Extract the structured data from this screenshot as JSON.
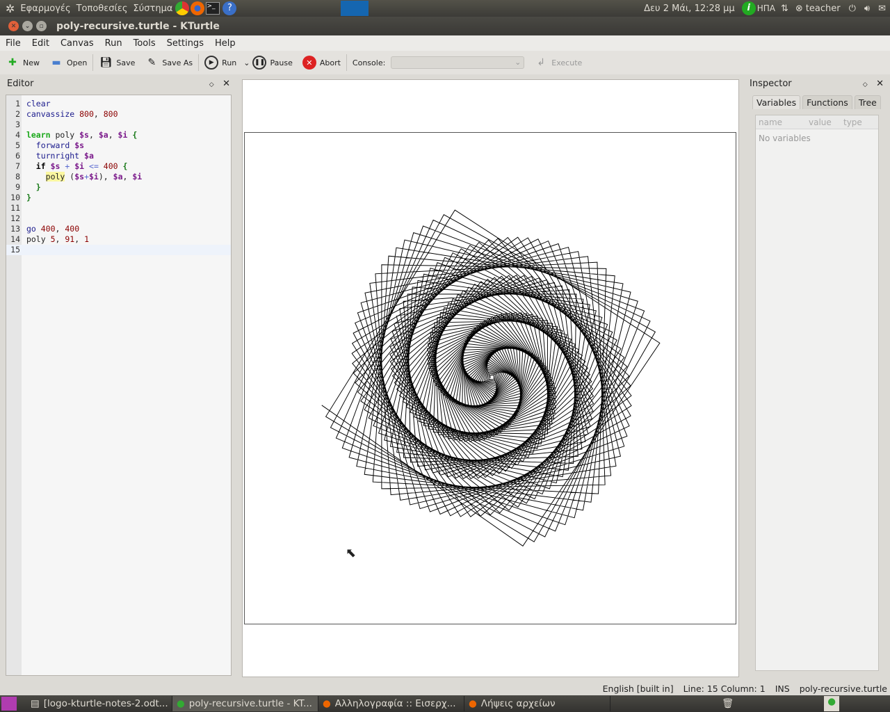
{
  "top_panel": {
    "menus": [
      "Εφαρμογές",
      "Τοποθεσίες",
      "Σύστημα"
    ],
    "clock": "Δευ  2 Μάι, 12:28 μμ",
    "keyboard": "ΗΠΑ",
    "user": "teacher"
  },
  "window": {
    "title": "poly-recursive.turtle - KTurtle"
  },
  "menubar": [
    "File",
    "Edit",
    "Canvas",
    "Run",
    "Tools",
    "Settings",
    "Help"
  ],
  "toolbar": {
    "new": "New",
    "open": "Open",
    "save": "Save",
    "save_as": "Save As",
    "run": "Run",
    "pause": "Pause",
    "abort": "Abort",
    "console_label": "Console:",
    "console_value": "",
    "execute": "Execute"
  },
  "editor": {
    "title": "Editor",
    "current_line": 15,
    "lines": [
      [
        [
          "clear",
          "cmd"
        ]
      ],
      [
        [
          "canvassize ",
          "cmd"
        ],
        [
          "800",
          "num"
        ],
        [
          ", ",
          "plain"
        ],
        [
          "800",
          "num"
        ]
      ],
      [],
      [
        [
          "learn",
          "learn"
        ],
        [
          " poly ",
          "plain"
        ],
        [
          "$s",
          "var"
        ],
        [
          ", ",
          "plain"
        ],
        [
          "$a",
          "var"
        ],
        [
          ", ",
          "plain"
        ],
        [
          "$i",
          "var"
        ],
        [
          " ",
          "plain"
        ],
        [
          "{",
          "brace"
        ]
      ],
      [
        [
          "  forward ",
          "cmd"
        ],
        [
          "$s",
          "var"
        ]
      ],
      [
        [
          "  turnright ",
          "cmd"
        ],
        [
          "$a",
          "var"
        ]
      ],
      [
        [
          "  ",
          "plain"
        ],
        [
          "if",
          "if"
        ],
        [
          " ",
          "plain"
        ],
        [
          "$s",
          "var"
        ],
        [
          " + ",
          "op"
        ],
        [
          "$i",
          "var"
        ],
        [
          " <= ",
          "op"
        ],
        [
          "400",
          "num"
        ],
        [
          " ",
          "plain"
        ],
        [
          "{",
          "brace"
        ]
      ],
      [
        [
          "    ",
          "plain"
        ],
        [
          "poly",
          "hl"
        ],
        [
          " (",
          "plain"
        ],
        [
          "$s",
          "var"
        ],
        [
          "+",
          "op"
        ],
        [
          "$i",
          "var"
        ],
        [
          "), ",
          "plain"
        ],
        [
          "$a",
          "var"
        ],
        [
          ", ",
          "plain"
        ],
        [
          "$i",
          "var"
        ]
      ],
      [
        [
          "  ",
          "plain"
        ],
        [
          "}",
          "brace"
        ]
      ],
      [
        [
          "}",
          "brace"
        ]
      ],
      [],
      [],
      [
        [
          "go ",
          "cmd"
        ],
        [
          "400",
          "num"
        ],
        [
          ", ",
          "plain"
        ],
        [
          "400",
          "num"
        ]
      ],
      [
        [
          "poly ",
          "plain"
        ],
        [
          "5",
          "num"
        ],
        [
          ", ",
          "plain"
        ],
        [
          "91",
          "num"
        ],
        [
          ", ",
          "plain"
        ],
        [
          "1",
          "num"
        ]
      ],
      []
    ]
  },
  "inspector": {
    "title": "Inspector",
    "tabs": [
      "Variables",
      "Functions",
      "Tree"
    ],
    "columns": [
      "name",
      "value",
      "type"
    ],
    "empty": "No variables"
  },
  "statusbar": {
    "language": "English [built in]",
    "position": "Line: 15 Column: 1",
    "mode": "INS",
    "file": "poly-recursive.turtle"
  },
  "taskbar": [
    "[logo-kturtle-notes-2.odt...",
    "poly-recursive.turtle - KT...",
    "Αλληλογραφία :: Εισερχ...",
    "Λήψεις αρχείων"
  ]
}
